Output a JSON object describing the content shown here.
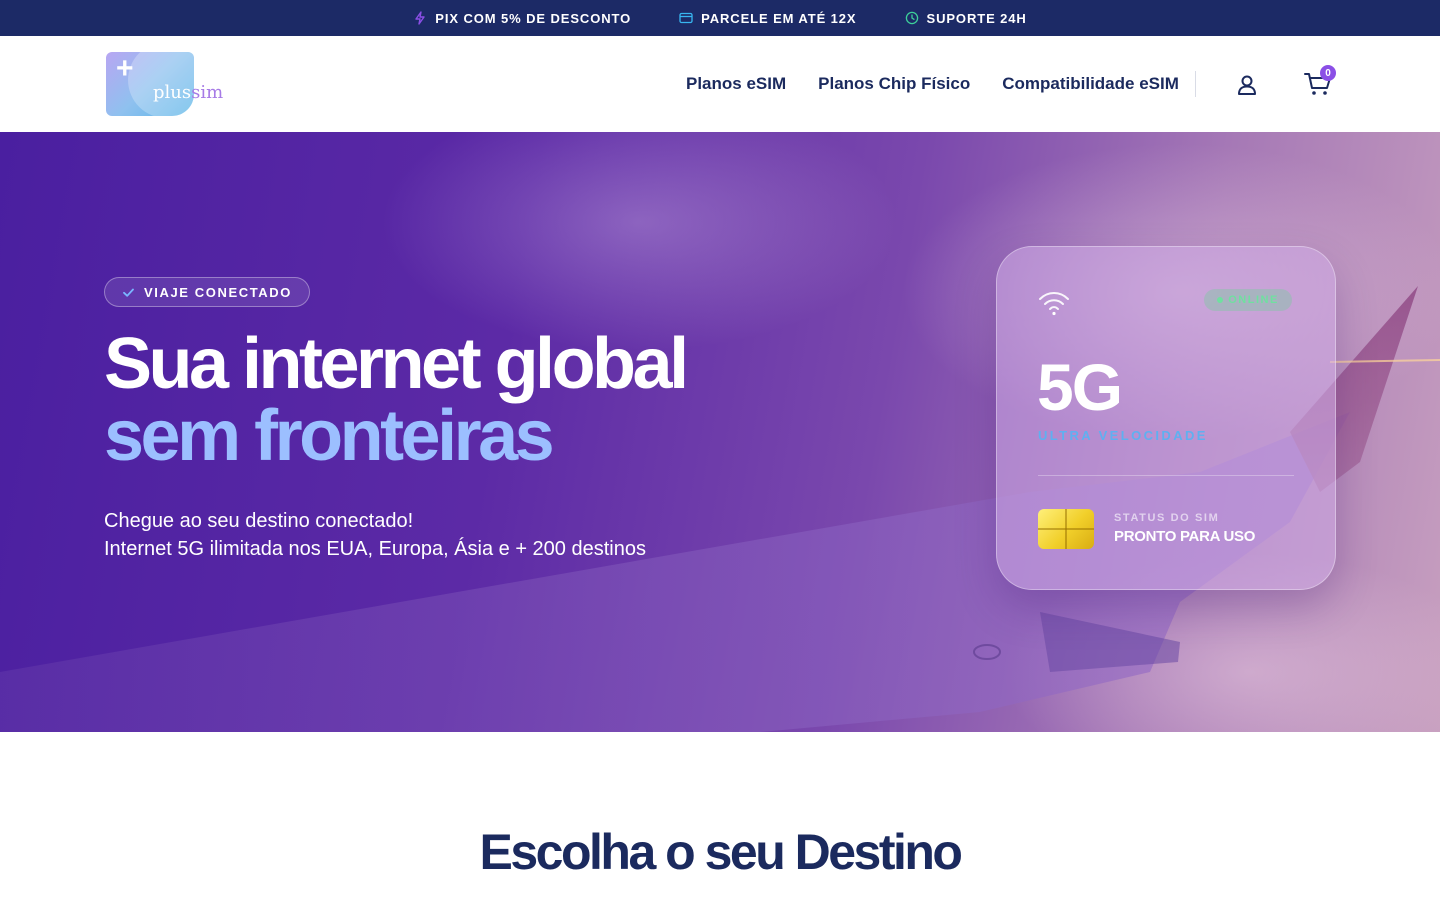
{
  "topbar": {
    "items": [
      {
        "icon": "lightning-icon",
        "label": "PIX COM 5% DE DESCONTO",
        "color": "#8b4fe6"
      },
      {
        "icon": "credit-card-icon",
        "label": "PARCELE EM ATÉ 12X",
        "color": "#38b6f0"
      },
      {
        "icon": "clock-icon",
        "label": "SUPORTE 24H",
        "color": "#3dcf9a"
      }
    ]
  },
  "header": {
    "logo": {
      "plus_text": "plus",
      "sim_text": "sim"
    },
    "nav": [
      "Planos eSIM",
      "Planos Chip Físico",
      "Compatibilidade eSIM"
    ],
    "user_icon": "user-icon",
    "cart_icon": "cart-icon",
    "cart_count": "0"
  },
  "hero": {
    "badge": "VIAJE CONECTADO",
    "title_line1": "Sua internet global",
    "title_line2": "sem fronteiras",
    "subtitle_line1": "Chegue ao seu destino conectado!",
    "subtitle_line2": "Internet 5G ilimitada nos EUA, Europa, Ásia e + 200 destinos",
    "card": {
      "wifi_icon": "wifi-icon",
      "status_pill": "ONLINE",
      "network": "5G",
      "speed_label": "ULTRA VELOCIDADE",
      "sim_status_label": "STATUS DO SIM",
      "sim_status_value": "PRONTO PARA USO"
    }
  },
  "section": {
    "title": "Escolha o seu Destino"
  },
  "colors": {
    "navy": "#1b2a5e",
    "topbar_bg": "#1c2a66",
    "accent_purple": "#8b4fe6",
    "hero_highlight": "#9cbfff"
  }
}
